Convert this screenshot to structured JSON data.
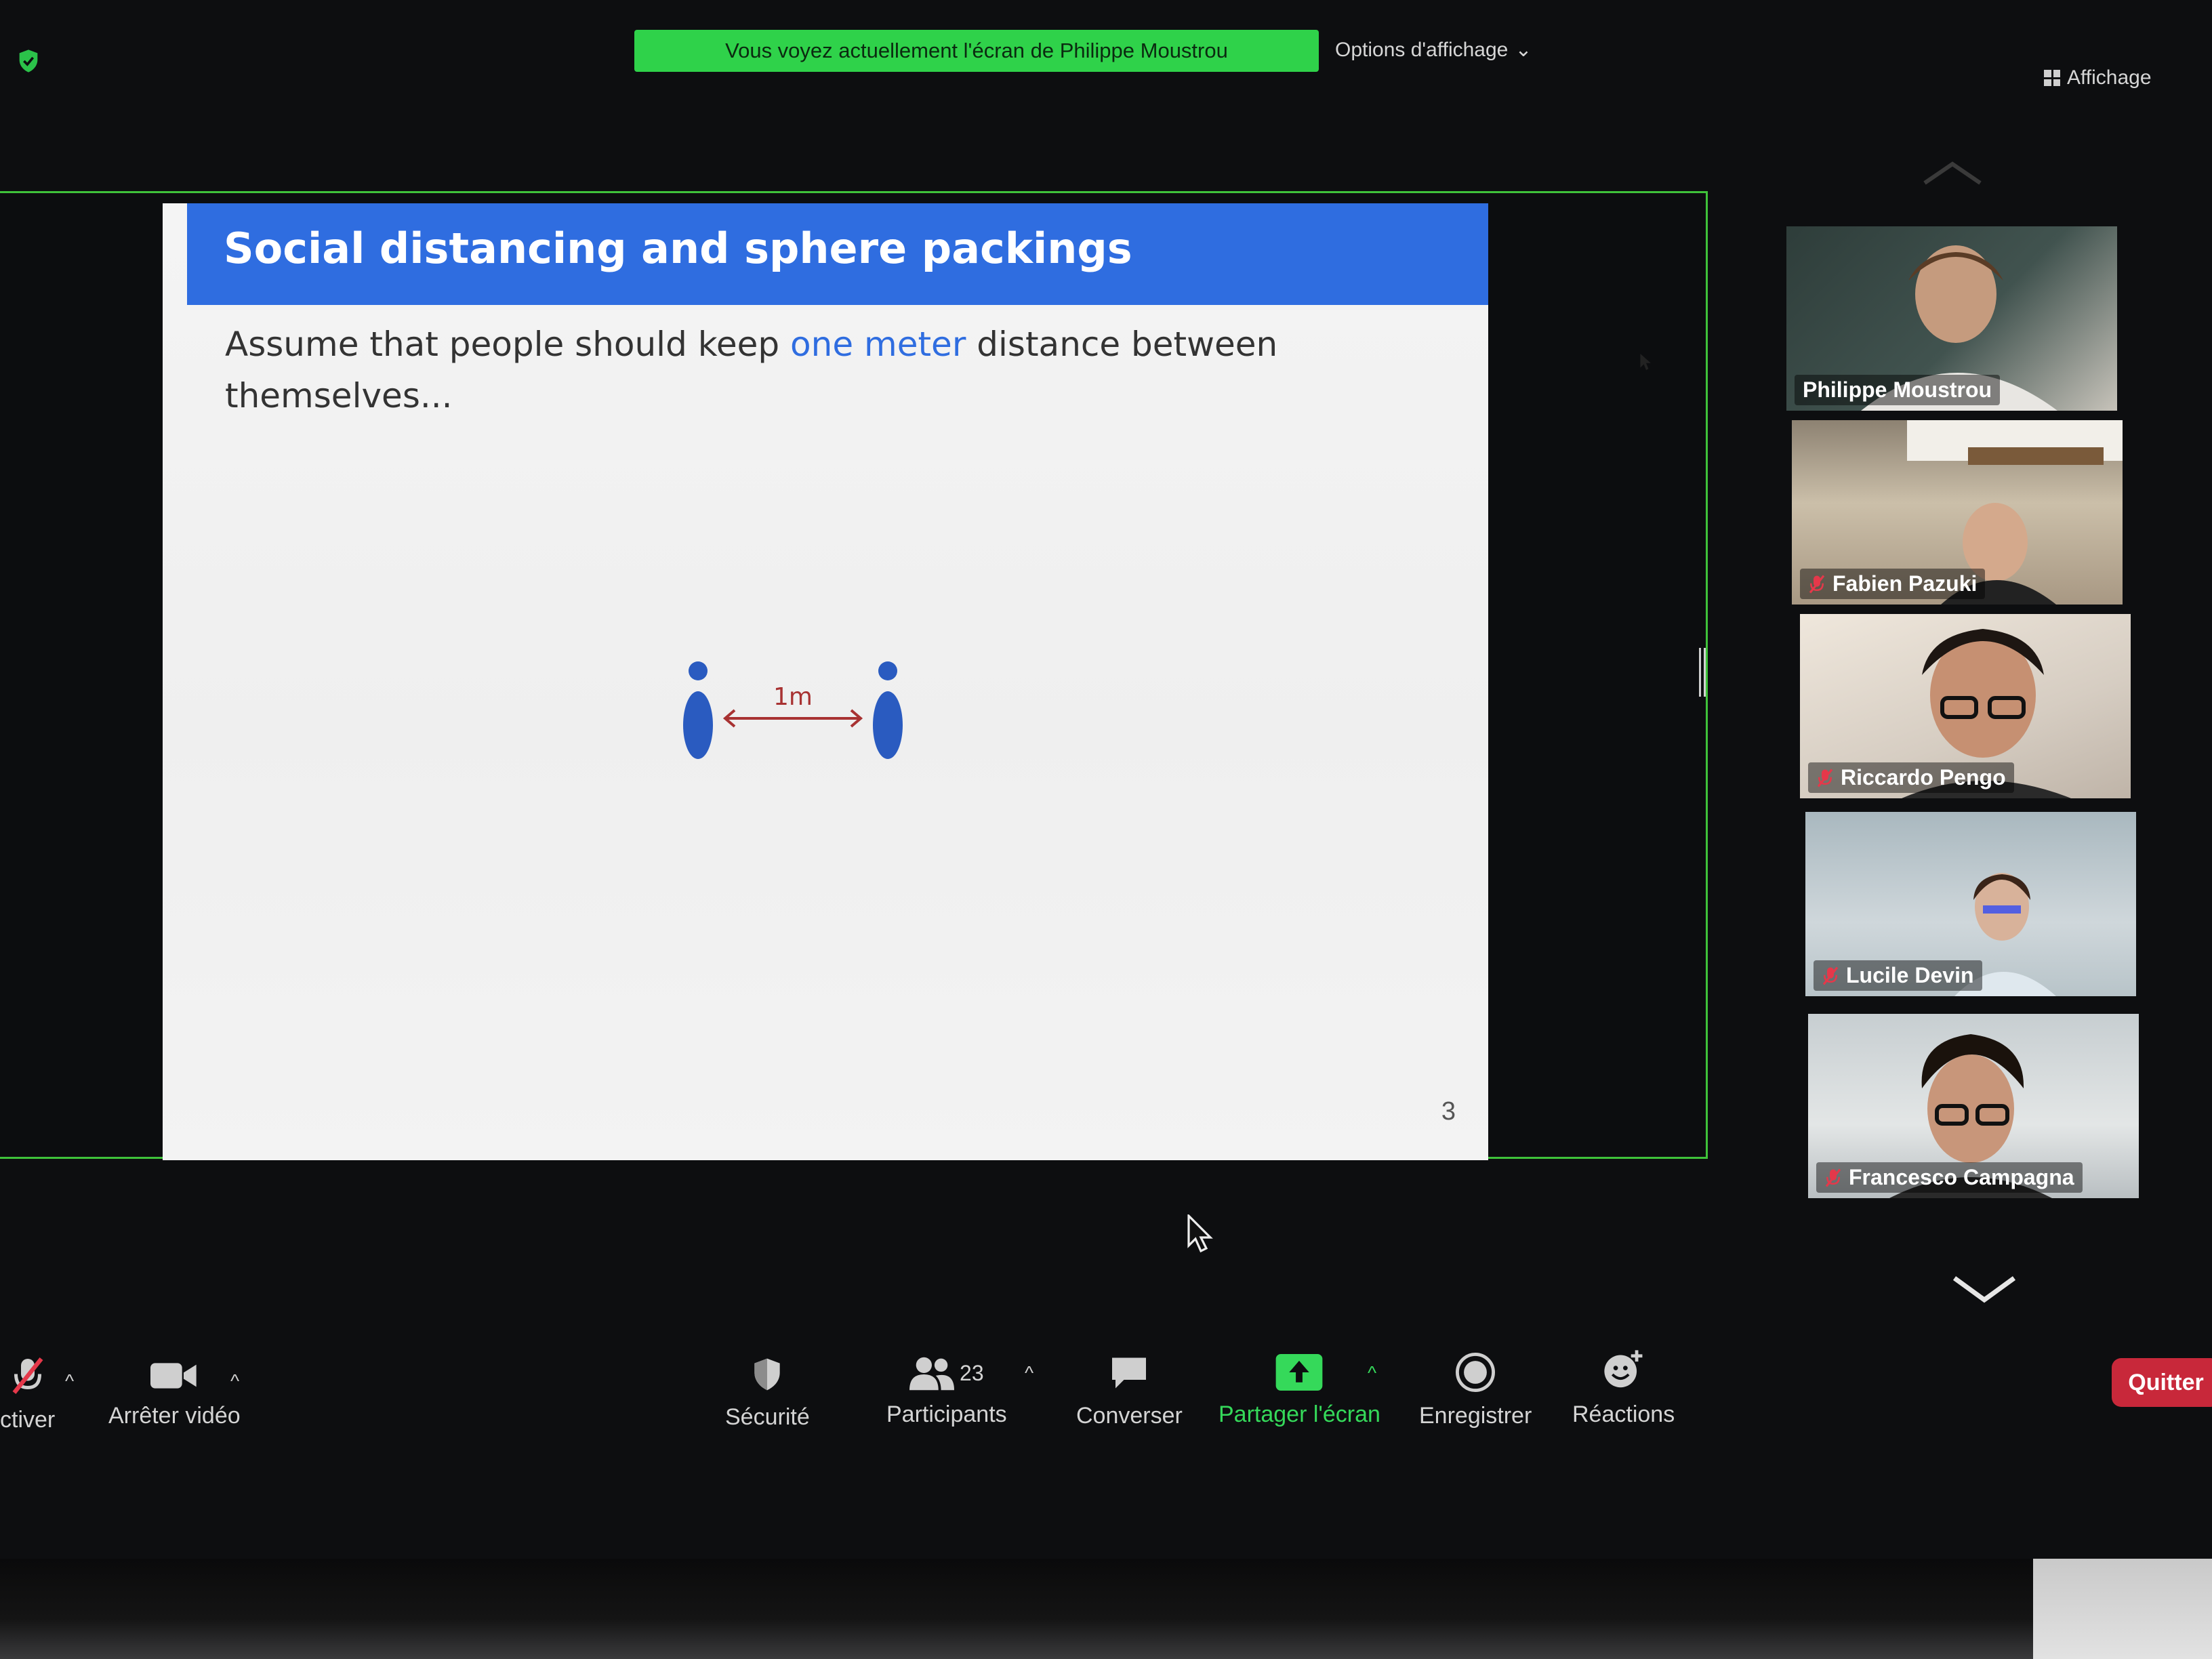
{
  "banner": {
    "sharing_text": "Vous voyez actuellement l'écran de Philippe Moustrou",
    "view_options": "Options d'affichage",
    "view_label": "Affichage"
  },
  "slide": {
    "title": "Social distancing and sphere packings",
    "body_pre": "Assume that people should keep ",
    "body_highlight": "one meter",
    "body_post": " distance between themselves...",
    "distance_label": "1m",
    "page_number": "3",
    "colors": {
      "header": "#2f6de0",
      "figure": "#2a5bc0",
      "arrow": "#a83232"
    }
  },
  "participants": [
    {
      "name": "Philippe Moustrou",
      "muted": false
    },
    {
      "name": "Fabien Pazuki",
      "muted": true
    },
    {
      "name": "Riccardo Pengo",
      "muted": true
    },
    {
      "name": "Lucile Devin",
      "muted": true
    },
    {
      "name": "Francesco Campagna",
      "muted": true
    }
  ],
  "toolbar": {
    "mute_label": "ctiver",
    "video_label": "Arrêter vidéo",
    "security_label": "Sécurité",
    "participants_count": "23",
    "participants_label": "Participants",
    "chat_label": "Converser",
    "share_label": "Partager l'écran",
    "record_label": "Enregistrer",
    "reactions_label": "Réactions",
    "leave_label": "Quitter"
  },
  "icons": {
    "shield": "shield-icon",
    "mute": "microphone-muted-icon",
    "video": "camera-icon",
    "participants": "people-icon",
    "chat": "speech-bubble-icon",
    "share": "share-arrow-icon",
    "record": "record-icon",
    "reactions": "smiley-plus-icon"
  },
  "accent_colors": {
    "green": "#35d95a",
    "leave": "#c8283a"
  }
}
